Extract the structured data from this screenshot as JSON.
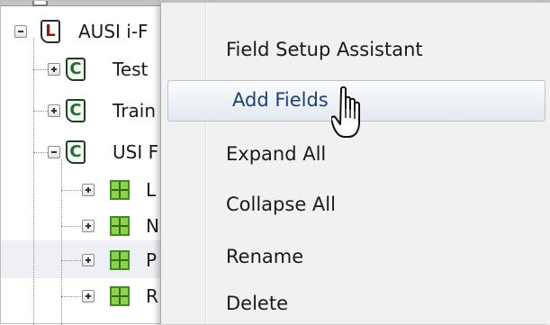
{
  "tree": {
    "nodes": [
      {
        "label": "AUSI i-F",
        "badge": "L"
      },
      {
        "label": "Test",
        "badge": "C"
      },
      {
        "label": "Train",
        "badge": "C"
      },
      {
        "label": "USI F",
        "badge": "C"
      },
      {
        "label": "L",
        "icon": "grid-icon"
      },
      {
        "label": "N",
        "icon": "grid-icon"
      },
      {
        "label": "P",
        "icon": "grid-icon"
      },
      {
        "label": "R",
        "icon": "grid-icon"
      }
    ]
  },
  "context_menu": {
    "items": [
      {
        "label": "Field Setup Assistant"
      },
      {
        "label": "Add Fields",
        "state": "hover"
      },
      {
        "label": "Expand All"
      },
      {
        "label": "Collapse All"
      },
      {
        "label": "Rename"
      },
      {
        "label": "Delete"
      }
    ]
  },
  "cursor": {
    "icon": "hand-pointer-icon"
  },
  "colors": {
    "menu_background": "#f1f1f1",
    "menu_hover_text": "#1d3f7a",
    "selected_row": "#eef0f5",
    "badge_l": "#8b1a1a",
    "badge_c": "#1f6e2f",
    "grid_icon": "#8fd14a"
  }
}
